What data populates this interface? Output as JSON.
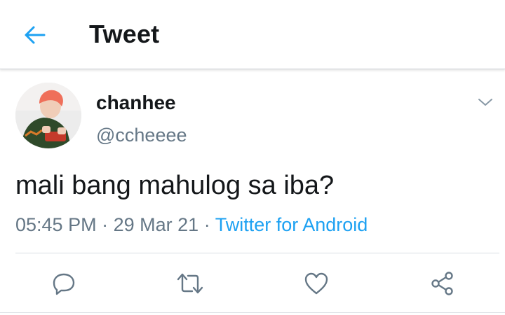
{
  "header": {
    "title": "Tweet",
    "back_icon": "arrow-left-icon"
  },
  "tweet": {
    "display_name": "chanhee",
    "handle": "@ccheeee",
    "text": "mali bang mahulog sa iba?",
    "time": "05:45 PM",
    "date": "29 Mar 21",
    "separator": "·",
    "source": "Twitter for Android",
    "menu_icon": "chevron-down-icon"
  },
  "actions": {
    "reply_icon": "reply-icon",
    "retweet_icon": "retweet-icon",
    "like_icon": "heart-icon",
    "share_icon": "share-icon"
  },
  "colors": {
    "accent": "#1da1f2",
    "secondary_text": "#657786",
    "primary_text": "#14171a",
    "icon": "#657786"
  }
}
